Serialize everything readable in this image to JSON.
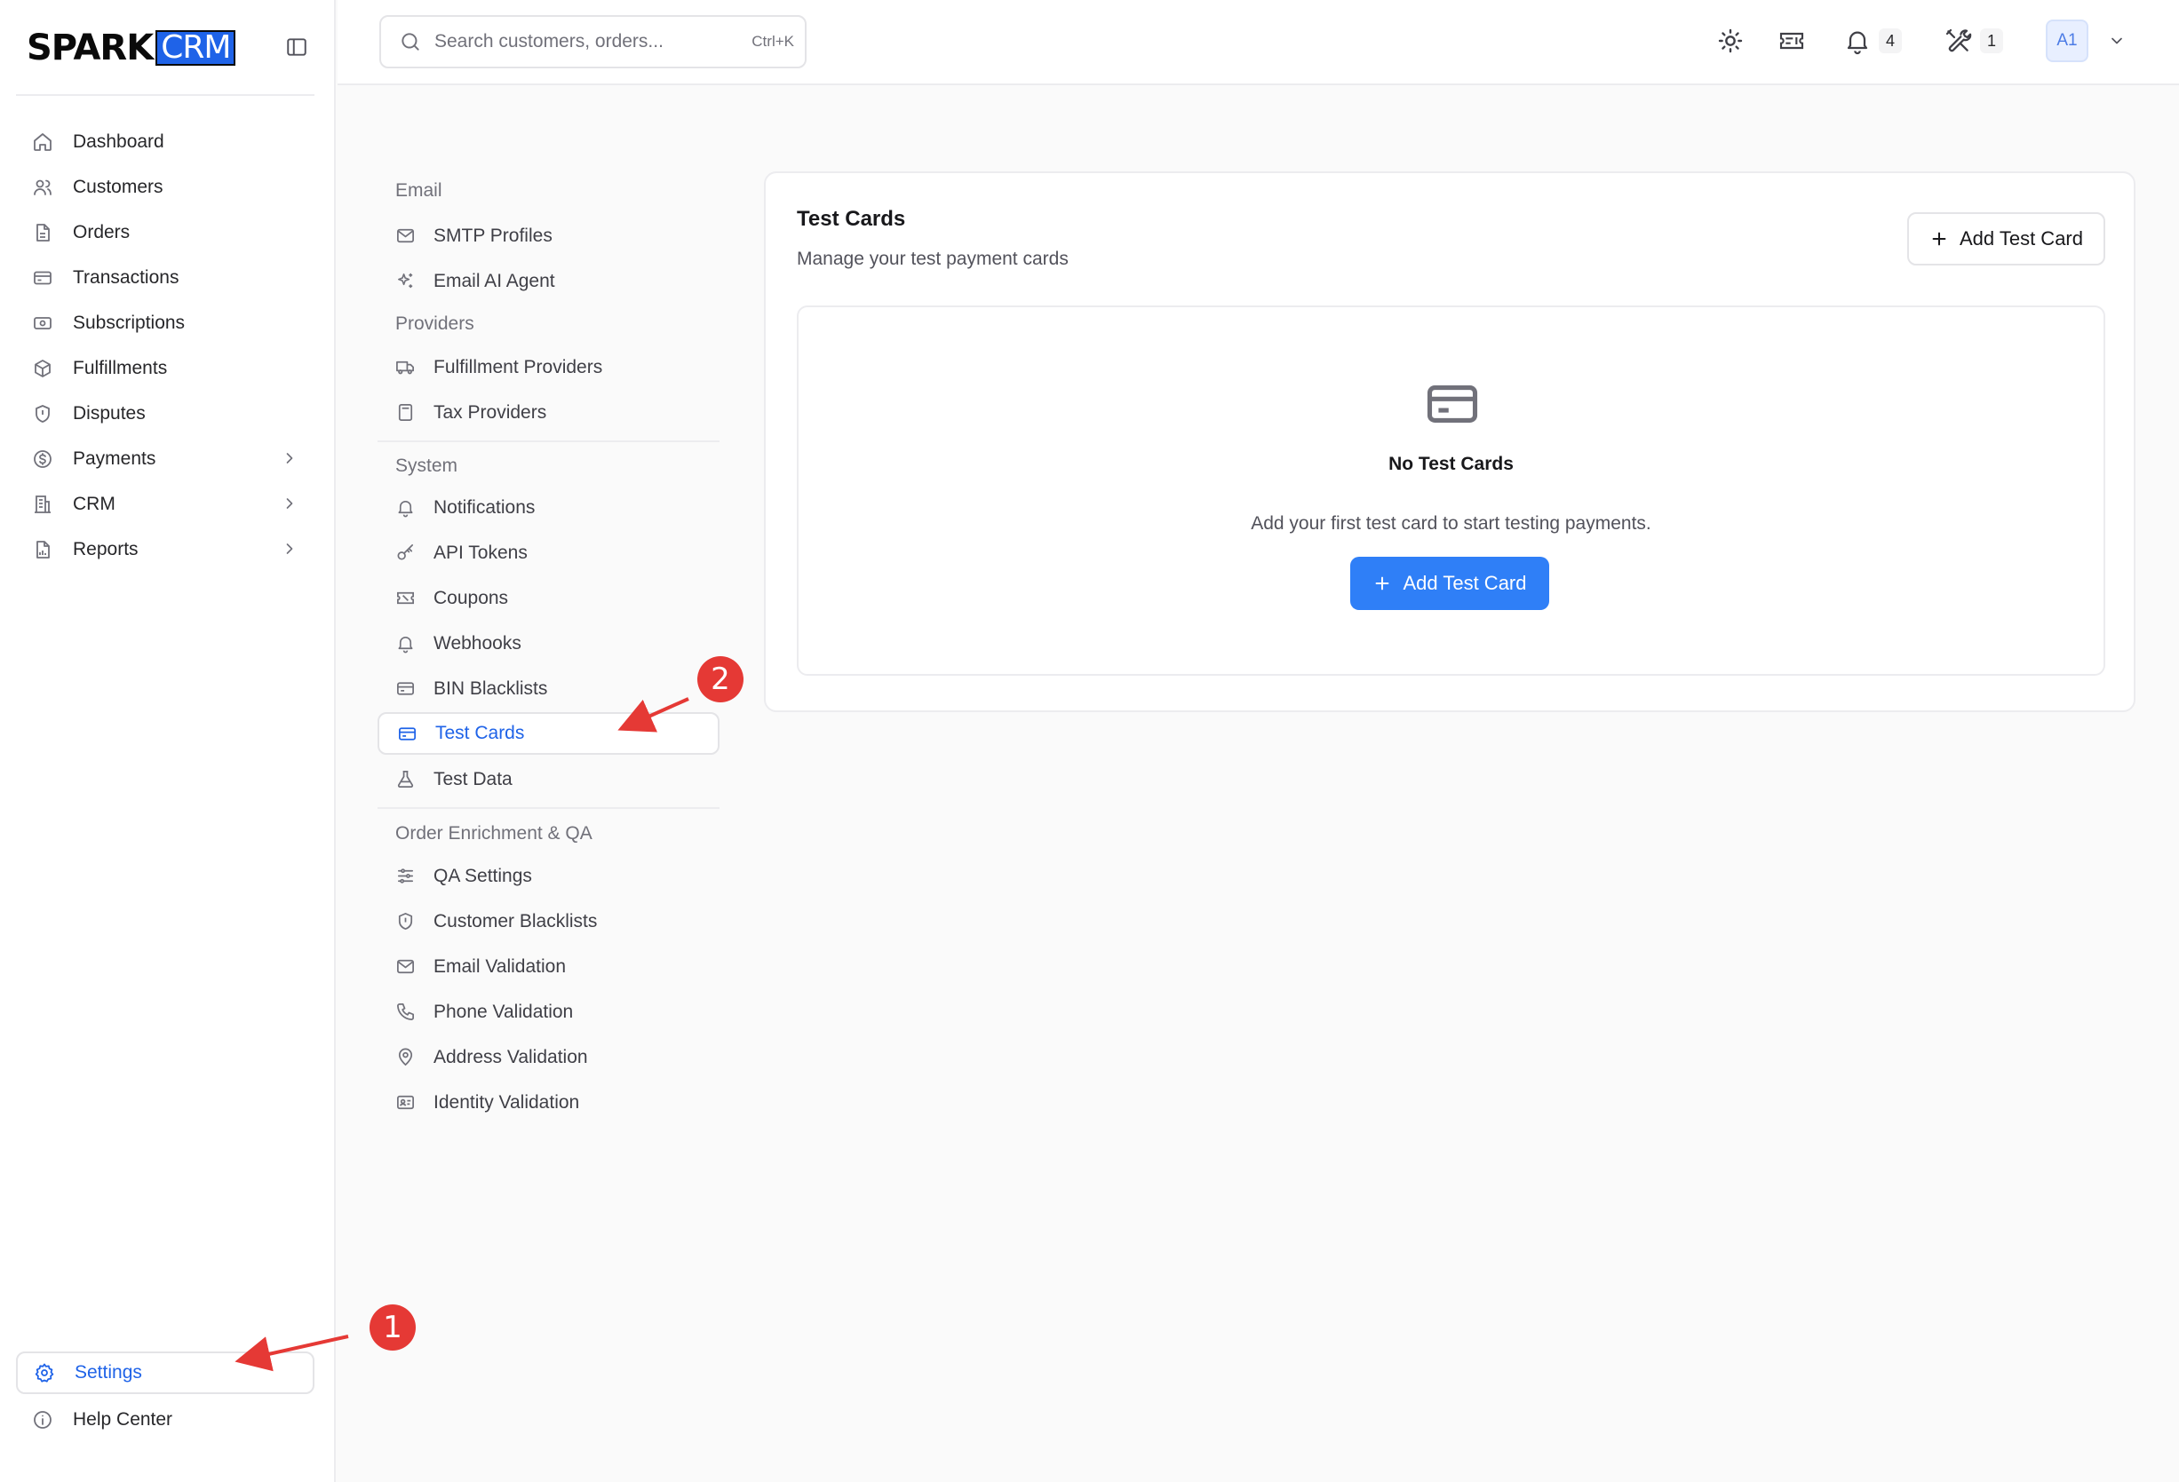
{
  "brand": {
    "spark": "SPARK",
    "crm": "CRM"
  },
  "sidebar": {
    "items": [
      {
        "label": "Dashboard",
        "icon": "home-icon"
      },
      {
        "label": "Customers",
        "icon": "users-icon"
      },
      {
        "label": "Orders",
        "icon": "file-icon"
      },
      {
        "label": "Transactions",
        "icon": "credit-card-icon"
      },
      {
        "label": "Subscriptions",
        "icon": "banknote-icon"
      },
      {
        "label": "Fulfillments",
        "icon": "package-icon"
      },
      {
        "label": "Disputes",
        "icon": "shield-icon"
      },
      {
        "label": "Payments",
        "icon": "dollar-circle-icon",
        "expandable": true
      },
      {
        "label": "CRM",
        "icon": "building-icon",
        "expandable": true
      },
      {
        "label": "Reports",
        "icon": "report-icon",
        "expandable": true
      }
    ],
    "settings": "Settings",
    "help": "Help Center"
  },
  "topbar": {
    "search_placeholder": "Search customers, orders...",
    "search_shortcut": "Ctrl+K",
    "notifications_count": "4",
    "tools_count": "1",
    "avatar": "A1"
  },
  "settings_nav": {
    "email_title": "Email",
    "smtp": "SMTP Profiles",
    "email_ai": "Email AI Agent",
    "providers_title": "Providers",
    "fulfillment_providers": "Fulfillment Providers",
    "tax_providers": "Tax Providers",
    "system_title": "System",
    "notifications": "Notifications",
    "api_tokens": "API Tokens",
    "coupons": "Coupons",
    "webhooks": "Webhooks",
    "bin_blacklists": "BIN Blacklists",
    "test_cards": "Test Cards",
    "test_data": "Test Data",
    "qa_title": "Order Enrichment & QA",
    "qa_settings": "QA Settings",
    "customer_blacklists": "Customer Blacklists",
    "email_validation": "Email Validation",
    "phone_validation": "Phone Validation",
    "address_validation": "Address Validation",
    "identity_validation": "Identity Validation"
  },
  "main": {
    "title": "Test Cards",
    "description": "Manage your test payment cards",
    "add_button": "Add Test Card",
    "empty_title": "No Test Cards",
    "empty_description": "Add your first test card to start testing payments.",
    "empty_button": "Add Test Card"
  },
  "annotations": {
    "step1": "1",
    "step2": "2",
    "color": "#e53935"
  }
}
